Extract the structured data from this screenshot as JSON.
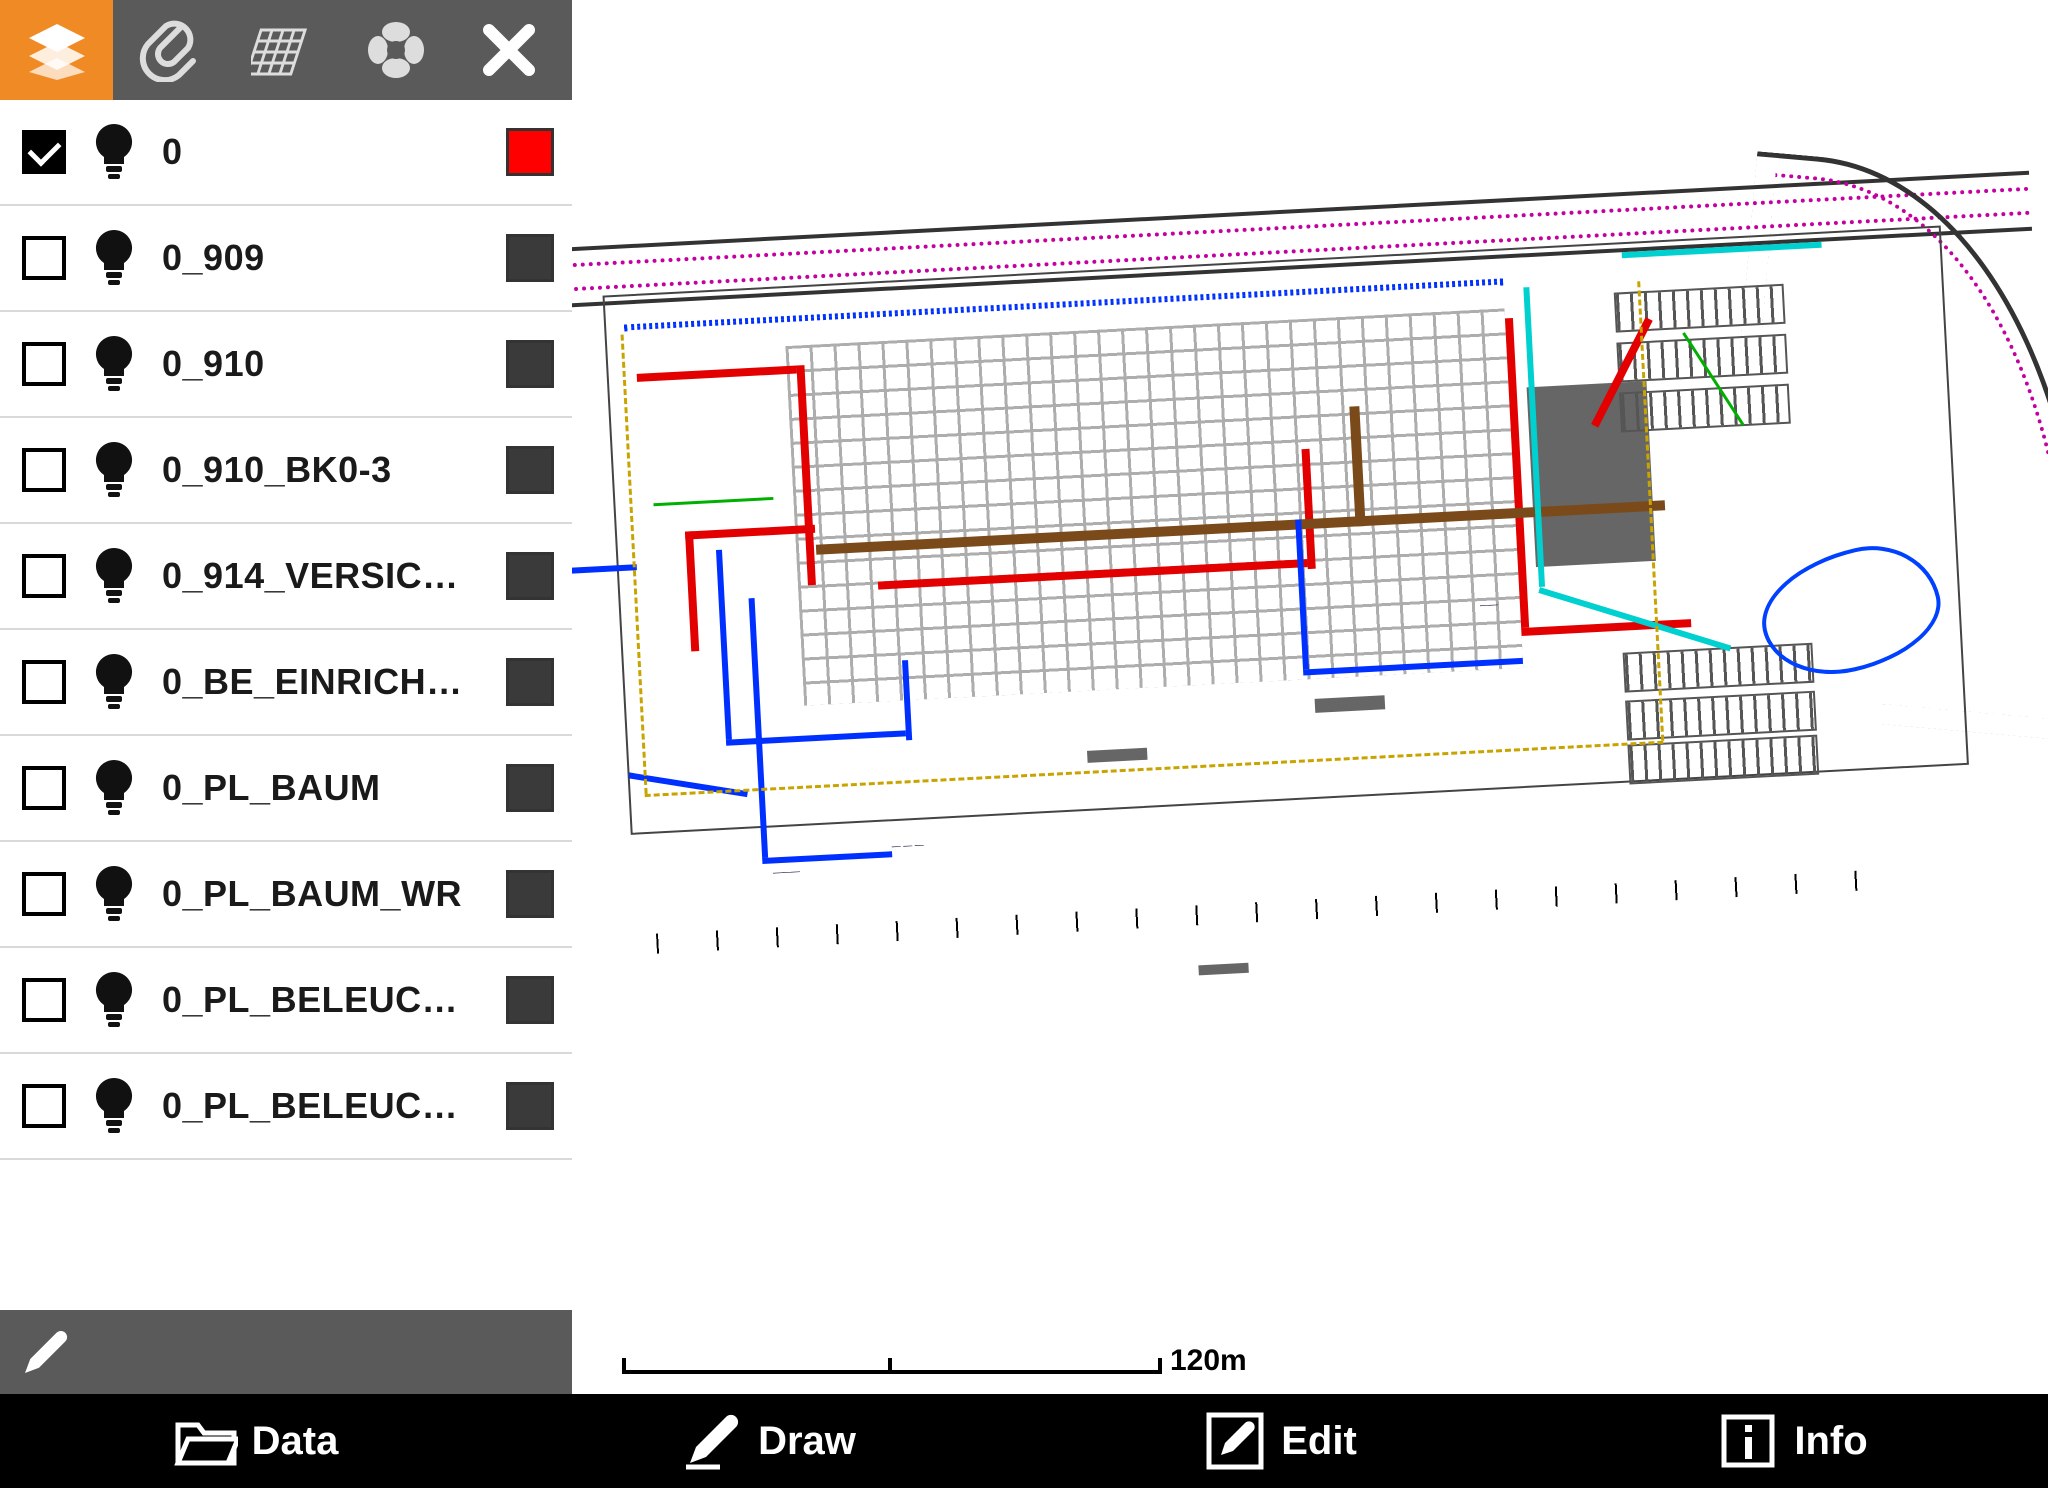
{
  "sidebar": {
    "layers": [
      {
        "label": "0",
        "checked": true,
        "color": "#ff0000"
      },
      {
        "label": "0_909",
        "checked": false,
        "color": "#3a3a3a"
      },
      {
        "label": "0_910",
        "checked": false,
        "color": "#3a3a3a"
      },
      {
        "label": "0_910_BK0-3",
        "checked": false,
        "color": "#3a3a3a"
      },
      {
        "label": "0_914_VERSIC…",
        "checked": false,
        "color": "#3a3a3a"
      },
      {
        "label": "0_BE_EINRICH…",
        "checked": false,
        "color": "#3a3a3a"
      },
      {
        "label": "0_PL_BAUM",
        "checked": false,
        "color": "#3a3a3a"
      },
      {
        "label": "0_PL_BAUM_WR",
        "checked": false,
        "color": "#3a3a3a"
      },
      {
        "label": "0_PL_BELEUC…",
        "checked": false,
        "color": "#3a3a3a"
      },
      {
        "label": "0_PL_BELEUC…",
        "checked": false,
        "color": "#3a3a3a"
      }
    ]
  },
  "scale": {
    "label": "120m"
  },
  "nav": {
    "data": "Data",
    "draw": "Draw",
    "edit": "Edit",
    "info": "Info"
  }
}
